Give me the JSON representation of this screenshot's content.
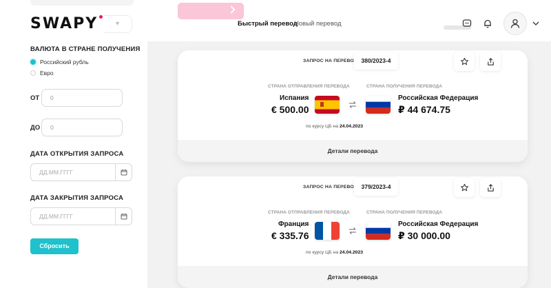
{
  "app": {
    "logo": "SWAPY"
  },
  "sidebar": {
    "currency_title": "ВАЛЮТА В СТРАНЕ ПОЛУЧЕНИЯ",
    "currencies": [
      {
        "label": "Российский рубль",
        "selected": true
      },
      {
        "label": "Евро",
        "selected": false
      }
    ],
    "from_label": "ОТ",
    "from_placeholder": "0",
    "to_label": "ДО",
    "to_placeholder": "0",
    "open_date_title": "ДАТА ОТКРЫТИЯ ЗАПРОСА",
    "open_date_placeholder": "ДД.ММ.ГГГГ",
    "close_date_title": "ДАТА ЗАКРЫТИЯ ЗАПРОСА",
    "close_date_placeholder": "ДД.ММ.ГГГГ",
    "reset_label": "Сбросить"
  },
  "header": {
    "tabs": [
      {
        "label": "Быстрый перевод",
        "active": true
      },
      {
        "label": "Новый перевод",
        "active": false
      }
    ],
    "icons": [
      "chat-icon",
      "bell-icon",
      "user-icon",
      "chevron-down-icon"
    ]
  },
  "cards": [
    {
      "request_label": "ЗАПРОС НА ПЕРЕВОД",
      "request_number": "380/2023-4",
      "sender_title": "СТРАНА ОТПРАВЛЕНИЯ ПЕРЕВОДА",
      "receiver_title": "СТРАНА ПОЛУЧЕНИЯ ПЕРЕВОДА",
      "sender_country": "Испания",
      "sender_amount": "€ 500.00",
      "receiver_country": "Российская Федерация",
      "receiver_amount": "₽ 44 674.75",
      "rate_prefix": "по курсу ЦБ на",
      "rate_date": "24.04.2023",
      "details_label": "Детали перевода"
    },
    {
      "request_label": "ЗАПРОС НА ПЕРЕВОД",
      "request_number": "379/2023-4",
      "sender_title": "СТРАНА ОТПРАВЛЕНИЯ ПЕРЕВОДА",
      "receiver_title": "СТРАНА ПОЛУЧЕНИЯ ПЕРЕВОДА",
      "sender_country": "Франция",
      "sender_amount": "€ 335.76",
      "receiver_country": "Российская Федерация",
      "receiver_amount": "₽ 30 000.00",
      "rate_prefix": "по курсу ЦБ на",
      "rate_date": "24.04.2023",
      "details_label": "Детали перевода"
    }
  ],
  "colors": {
    "accent": "#1ec1cc",
    "brand_pink": "#e6195e"
  }
}
